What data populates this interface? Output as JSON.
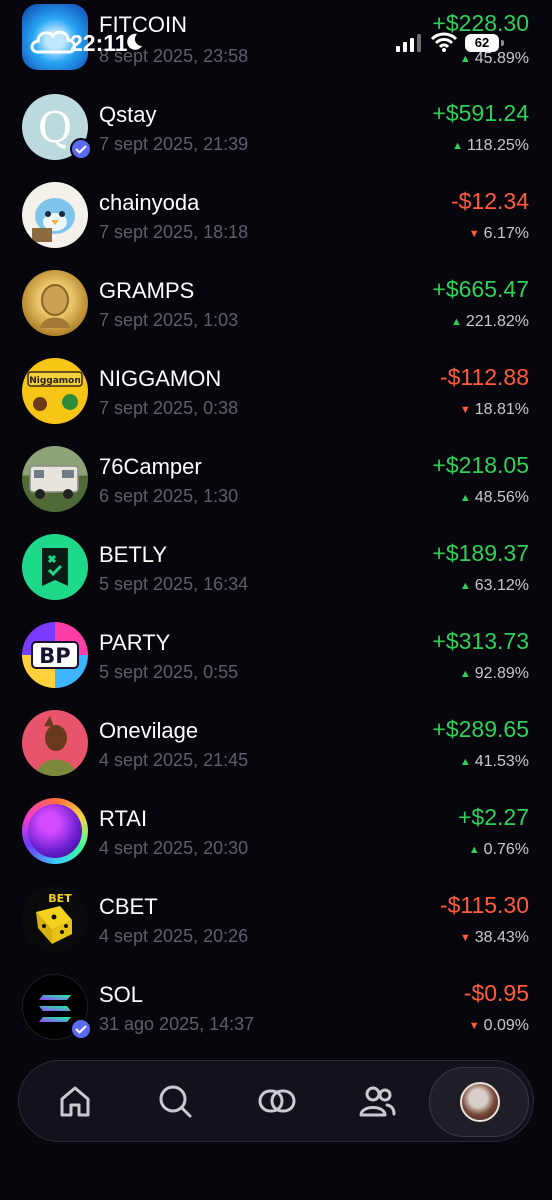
{
  "status_bar": {
    "time": "22:11",
    "battery": "62",
    "icons": [
      "cloud-icon",
      "moon-icon",
      "signal-icon",
      "wifi-icon",
      "battery-icon"
    ]
  },
  "colors": {
    "background": "#07060c",
    "positive": "#2fd15b",
    "negative": "#ff5c3a",
    "date_text": "#5f5e68"
  },
  "tokens": [
    {
      "name": "FITCOIN",
      "date": "8 sept 2025, 23:58",
      "amount": "+$228.30",
      "percent": "45.89%",
      "direction": "up"
    },
    {
      "name": "Qstay",
      "date": "7 sept 2025, 21:39",
      "amount": "+$591.24",
      "percent": "118.25%",
      "direction": "up"
    },
    {
      "name": "chainyoda",
      "date": "7 sept 2025, 18:18",
      "amount": "-$12.34",
      "percent": "6.17%",
      "direction": "down"
    },
    {
      "name": "GRAMPS",
      "date": "7 sept 2025, 1:03",
      "amount": "+$665.47",
      "percent": "221.82%",
      "direction": "up"
    },
    {
      "name": "NIGGAMON",
      "date": "7 sept 2025, 0:38",
      "amount": "-$112.88",
      "percent": "18.81%",
      "direction": "down"
    },
    {
      "name": "76Camper",
      "date": "6 sept 2025, 1:30",
      "amount": "+$218.05",
      "percent": "48.56%",
      "direction": "up"
    },
    {
      "name": "BETLY",
      "date": "5 sept 2025, 16:34",
      "amount": "+$189.37",
      "percent": "63.12%",
      "direction": "up"
    },
    {
      "name": "PARTY",
      "date": "5 sept 2025, 0:55",
      "amount": "+$313.73",
      "percent": "92.89%",
      "direction": "up"
    },
    {
      "name": "Onevilage",
      "date": "4 sept 2025, 21:45",
      "amount": "+$289.65",
      "percent": "41.53%",
      "direction": "up"
    },
    {
      "name": "RTAI",
      "date": "4 sept 2025, 20:30",
      "amount": "+$2.27",
      "percent": "0.76%",
      "direction": "up"
    },
    {
      "name": "CBET",
      "date": "4 sept 2025, 20:26",
      "amount": "-$115.30",
      "percent": "38.43%",
      "direction": "down"
    },
    {
      "name": "SOL",
      "date": "31 ago 2025, 14:37",
      "amount": "-$0.95",
      "percent": "0.09%",
      "direction": "down"
    }
  ],
  "avatar_text": {
    "niggamon": "Niggamon",
    "party": "BP",
    "cbet": "BET"
  },
  "nav": {
    "items": [
      "home-icon",
      "search-icon",
      "swap-icon",
      "community-icon",
      "profile-avatar"
    ],
    "active": "profile-avatar"
  }
}
